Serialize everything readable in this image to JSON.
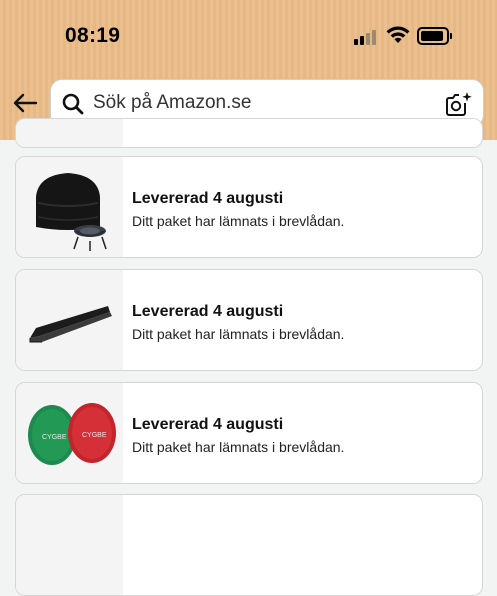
{
  "status_bar": {
    "time": "08:19",
    "icons": [
      "cellular-signal-icon",
      "wifi-icon",
      "battery-icon"
    ]
  },
  "search": {
    "placeholder": "Sök på Amazon.se",
    "icons": [
      "back-arrow-icon",
      "search-icon",
      "camera-sparkle-icon"
    ]
  },
  "colors": {
    "header_bg": "#ecc08e",
    "page_bg": "#f2f3f3"
  },
  "orders": [
    {
      "title": "Levererad 4 augusti",
      "subtitle": "Ditt paket har lämnats i brevlådan.",
      "image_icon": "fire-pit-cover-image"
    },
    {
      "title": "Levererad 4 augusti",
      "subtitle": "Ditt paket har lämnats i brevlådan.",
      "image_icon": "black-rail-bracket-image"
    },
    {
      "title": "Levererad 4 augusti",
      "subtitle": "Ditt paket har lämnats i brevlådan.",
      "image_icon": "red-green-light-covers-image",
      "image_text": [
        "CYGBE",
        "CYGBE"
      ]
    }
  ]
}
